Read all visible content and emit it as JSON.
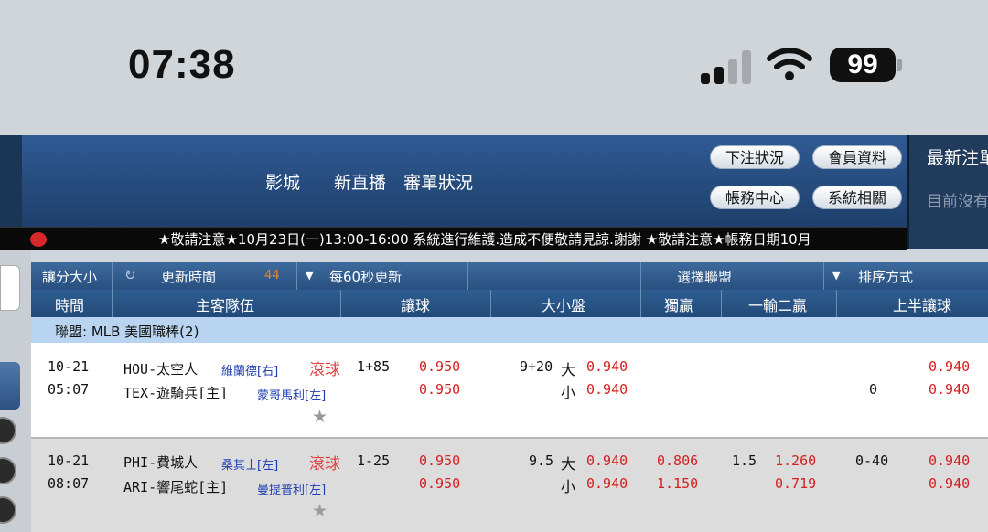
{
  "status_bar": {
    "time": "07:38",
    "battery": "99"
  },
  "header": {
    "nav": [
      "影城",
      "新直播",
      "審單狀況"
    ],
    "buttons": [
      "下注狀況",
      "會員資料",
      "帳務中心",
      "系統相關"
    ],
    "side_title": "最新注單",
    "side_sub": "目前沒有"
  },
  "marquee": "★敬請注意★10月23日(一)13:00-16:00 系統進行維護.造成不便敬請見諒.謝謝 ★敬請注意★帳務日期10月",
  "toolbar": {
    "handicap_size": "讓分大小",
    "refresh_time": "更新時間",
    "countdown": "44",
    "refresh_interval": "每60秒更新",
    "select_league": "選擇聯盟",
    "sort_mode": "排序方式"
  },
  "columns": {
    "time": "時間",
    "teams": "主客隊伍",
    "handicap": "讓球",
    "over_under": "大小盤",
    "moneyline": "獨贏",
    "one_lose_two_win": "一輸二贏",
    "first_half_handicap": "上半讓球"
  },
  "league": "聯盟: MLB 美國職棒(2)",
  "matches": [
    {
      "date": "10-21",
      "time": "05:07",
      "team1": "HOU-太空人",
      "pitcher1": "維蘭德[右]",
      "team2": "TEX-遊騎兵[主]",
      "pitcher2": "蒙哥馬利[左]",
      "live": "滾球",
      "handicap_line": "1+85",
      "handicap_odds1": "0.950",
      "handicap_odds2": "0.950",
      "ou_line": "9+20",
      "ou_over": "大",
      "ou_under": "小",
      "ou_odds1": "0.940",
      "ou_odds2": "0.940",
      "ml_odds1": "",
      "ml_odds2": "",
      "olw_line": "",
      "olw_odds1": "",
      "olw_odds2": "",
      "fh_line1": "",
      "fh_line2": "0",
      "fh_odds1": "0.940",
      "fh_odds2": "0.940"
    },
    {
      "date": "10-21",
      "time": "08:07",
      "team1": "PHI-費城人",
      "pitcher1": "桑其士[左]",
      "team2": "ARI-響尾蛇[主]",
      "pitcher2": "曼提普利[左]",
      "live": "滾球",
      "handicap_line": "1-25",
      "handicap_odds1": "0.950",
      "handicap_odds2": "0.950",
      "ou_line": "9.5",
      "ou_over": "大",
      "ou_under": "小",
      "ou_odds1": "0.940",
      "ou_odds2": "0.940",
      "ml_odds1": "0.806",
      "ml_odds2": "1.150",
      "olw_line": "1.5",
      "olw_odds1": "1.260",
      "olw_odds2": "0.719",
      "fh_line1": "0-40",
      "fh_line2": "",
      "fh_odds1": "0.940",
      "fh_odds2": "0.940"
    }
  ]
}
